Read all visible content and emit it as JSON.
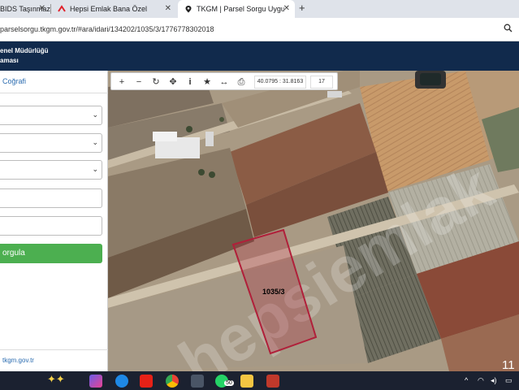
{
  "browser": {
    "tabs": [
      {
        "title": "BIDS Taşınmaz"
      },
      {
        "title": "Hepsi Emlak Bana Özel"
      },
      {
        "title": "TKGM | Parsel Sorgu Uygulama"
      }
    ],
    "new_tab_label": "+",
    "url": "parselsorgu.tkgm.gov.tr/#ara/idari/134202/1035/3/1776778302018"
  },
  "header": {
    "line1": "enel Müdürlüğü",
    "line2": "aması"
  },
  "panel": {
    "tab_label": "Coğrafi",
    "query_button_label": "orgula",
    "footer_link": "tkgm.gov.tr"
  },
  "map": {
    "coordinates": "40.0795 : 31.8163",
    "zoom_level": "17",
    "parcel_label": "1035/3",
    "watermark": "hepsiemlak",
    "parcel_color": "#b0203a"
  },
  "taskbar": {
    "clock": "11",
    "badge": "50"
  },
  "colors": {
    "header_bg": "#112a4c",
    "button_bg": "#4caf50",
    "link": "#2b6cb0"
  }
}
